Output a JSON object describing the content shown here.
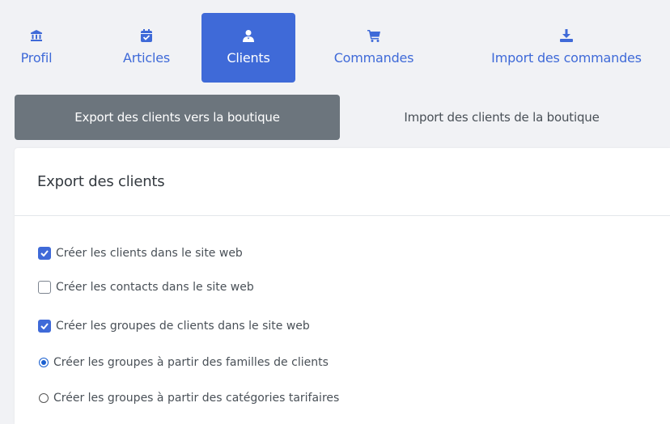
{
  "nav": {
    "tabs": [
      {
        "label": "Profil",
        "icon": "bank-icon"
      },
      {
        "label": "Articles",
        "icon": "calendar-check-icon"
      },
      {
        "label": "Clients",
        "icon": "users-icon"
      },
      {
        "label": "Commandes",
        "icon": "cart-icon"
      },
      {
        "label": "Import des commandes",
        "icon": "download-icon"
      }
    ],
    "active_tab": "Clients"
  },
  "subtabs": [
    {
      "label": "Export des clients vers la boutique"
    },
    {
      "label": "Import des clients de la boutique"
    }
  ],
  "card": {
    "title": "Export des clients",
    "options": [
      {
        "label": "Créer les clients dans le site web",
        "type": "checkbox",
        "checked": true
      },
      {
        "label": "Créer les contacts dans le site web",
        "type": "checkbox",
        "checked": false
      },
      {
        "label": "Créer les groupes de clients dans le site web",
        "type": "checkbox",
        "checked": true
      },
      {
        "label": "Créer les groupes à partir des familles de clients",
        "type": "radio",
        "checked": true
      },
      {
        "label": "Créer les groupes à partir des catégories tarifaires",
        "type": "radio",
        "checked": false
      }
    ]
  },
  "colors": {
    "accent": "#3f6ad8",
    "subtab_active": "#6c757d",
    "background": "#f1f2f5"
  }
}
